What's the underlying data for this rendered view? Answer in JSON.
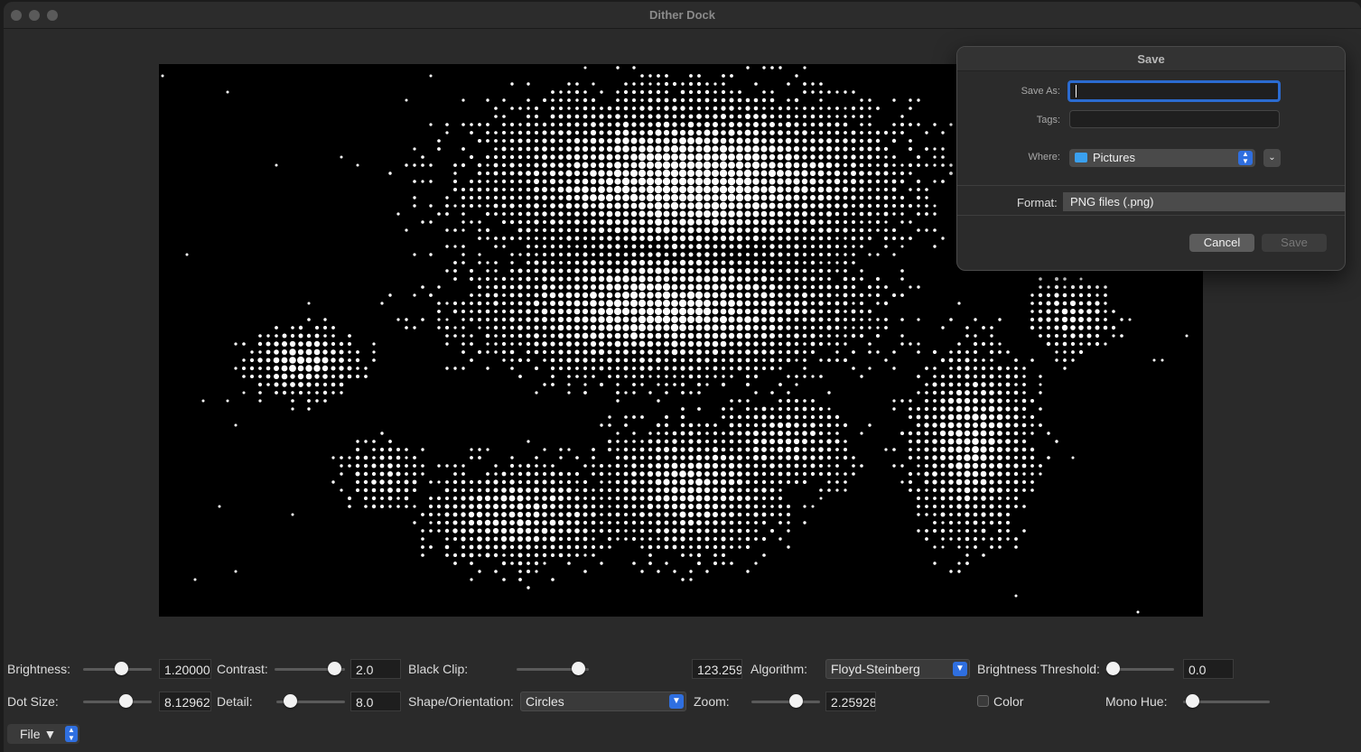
{
  "window": {
    "title": "Dither Dock"
  },
  "controls": {
    "brightness": {
      "label": "Brightness:",
      "value": "1.20000",
      "level": 0.55
    },
    "contrast": {
      "label": "Contrast:",
      "value": "2.0",
      "level": 0.85
    },
    "black_clip": {
      "label": "Black Clip:",
      "value": "123.259",
      "level": 0.85
    },
    "algorithm": {
      "label": "Algorithm:",
      "selected": "Floyd-Steinberg"
    },
    "brightness_threshold": {
      "label": "Brightness Threshold:",
      "value": "0.0",
      "level": 0.1
    },
    "dot_size": {
      "label": "Dot Size:",
      "value": "8.12962",
      "level": 0.62
    },
    "detail": {
      "label": "Detail:",
      "value": "8.0",
      "level": 0.2
    },
    "shape": {
      "label": "Shape/Orientation:",
      "selected": "Circles"
    },
    "zoom": {
      "label": "Zoom:",
      "value": "2.25928",
      "level": 0.65
    },
    "color": {
      "label": "Color",
      "checked": false
    },
    "mono_hue": {
      "label": "Mono Hue:",
      "level": 0.1
    },
    "file_menu": {
      "label": "File ▼"
    }
  },
  "save_dialog": {
    "title": "Save",
    "save_as_label": "Save As:",
    "save_as_value": "",
    "tags_label": "Tags:",
    "where_label": "Where:",
    "where_value": "Pictures",
    "format_label": "Format:",
    "format_value": "PNG files (.png)",
    "cancel_label": "Cancel",
    "save_label": "Save"
  },
  "icons": {
    "folder": "folder-icon",
    "chevron": "chevron-down-icon",
    "stepper": "up-down-stepper-icon"
  }
}
